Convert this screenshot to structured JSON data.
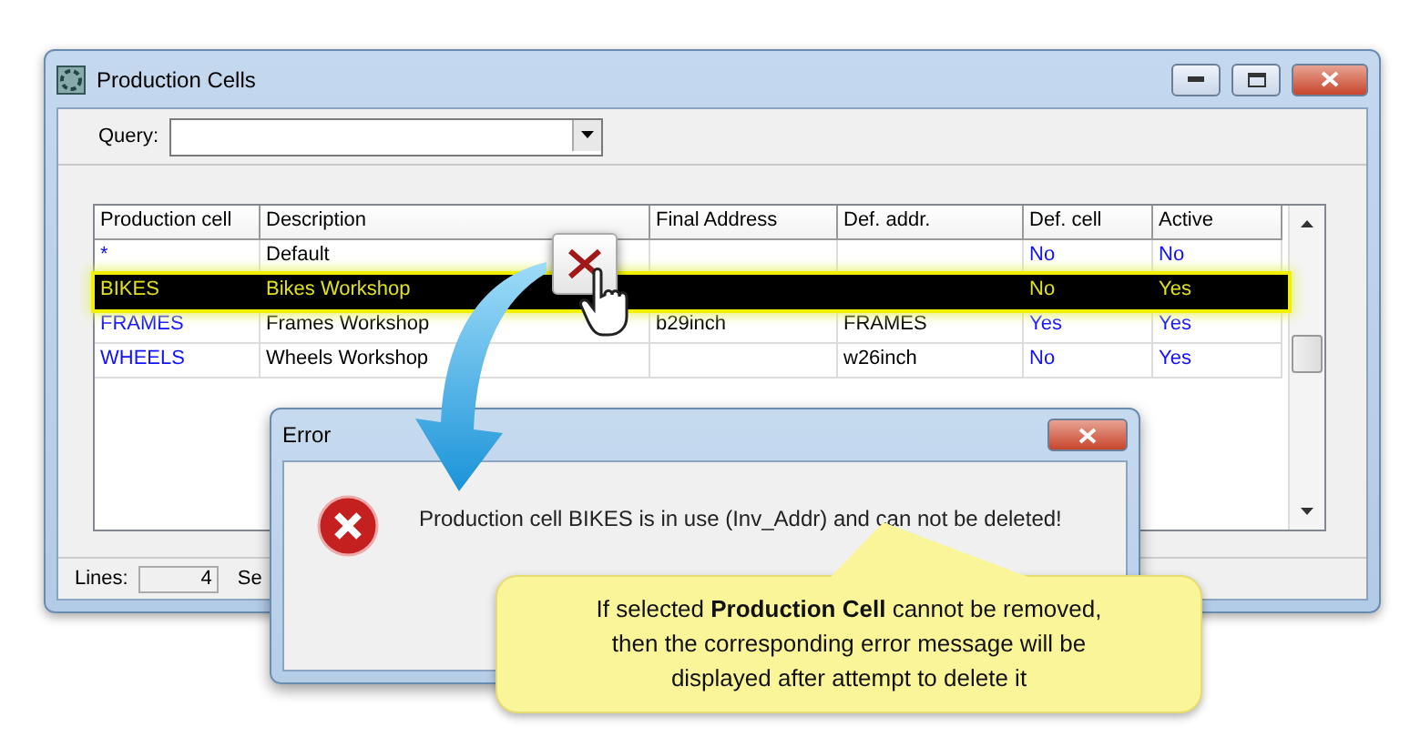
{
  "window": {
    "title": "Production Cells"
  },
  "query": {
    "label": "Query:"
  },
  "table": {
    "columns": [
      {
        "label": "Production cell",
        "accent": true
      },
      {
        "label": "Description",
        "accent": false
      },
      {
        "label": "Final Address",
        "accent": false
      },
      {
        "label": "Def. addr.",
        "accent": false
      },
      {
        "label": "Def. cell",
        "accent": true
      },
      {
        "label": "Active",
        "accent": true
      }
    ],
    "rows": [
      {
        "cells": [
          "*",
          "Default",
          "",
          "",
          "No",
          "No"
        ],
        "selected": false
      },
      {
        "cells": [
          "BIKES",
          "Bikes Workshop",
          "",
          "",
          "No",
          "Yes"
        ],
        "selected": true
      },
      {
        "cells": [
          "FRAMES",
          "Frames Workshop",
          "b29inch",
          "FRAMES",
          "Yes",
          "Yes"
        ],
        "selected": false
      },
      {
        "cells": [
          "WHEELS",
          "Wheels Workshop",
          "",
          "w26inch",
          "No",
          "Yes"
        ],
        "selected": false
      }
    ]
  },
  "status_bar": {
    "lines_label": "Lines:",
    "lines_value": "4",
    "next_label": "Se"
  },
  "error_dialog": {
    "title": "Error",
    "message": "Production cell BIKES is in use (Inv_Addr) and can not be deleted!"
  },
  "callout": {
    "text": "If selected **Production Cell** cannot be removed, then the corresponding error message will be displayed after attempt to delete it"
  }
}
